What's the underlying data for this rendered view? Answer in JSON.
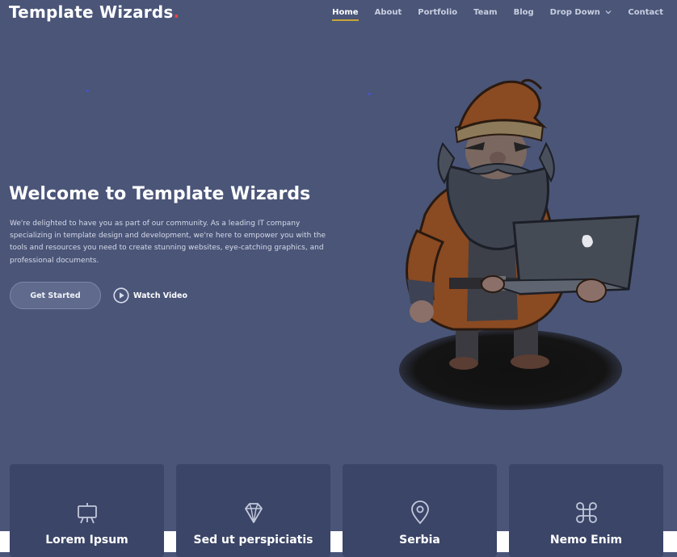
{
  "brand": {
    "name": "Template Wizards",
    "dot": ".",
    "accent_color": "#e84545"
  },
  "nav": {
    "items": [
      {
        "label": "Home",
        "active": true
      },
      {
        "label": "About"
      },
      {
        "label": "Portfolio"
      },
      {
        "label": "Team"
      },
      {
        "label": "Blog"
      },
      {
        "label": "Drop Down",
        "icon": "chevron-down-icon"
      },
      {
        "label": "Contact"
      }
    ],
    "active_underline_color": "#c8a43a"
  },
  "hero": {
    "title": "Welcome to Template Wizards",
    "text": "We're delighted to have you as part of our community. As a leading IT company specializing in template design and development, we're here to empower you with the tools and resources you need to create stunning websites, eye-catching graphics, and professional documents.",
    "primary_button": "Get Started",
    "video_button": "Watch Video",
    "illustration": "wizard-with-laptop-illustration"
  },
  "cards": [
    {
      "icon": "presentation-board-icon",
      "title": "Lorem Ipsum",
      "subtitle": ""
    },
    {
      "icon": "diamond-icon",
      "title": "Sed ut perspiciatis",
      "subtitle": ""
    },
    {
      "icon": "map-pin-icon",
      "title": "Serbia",
      "subtitle": ""
    },
    {
      "icon": "command-icon",
      "title": "Nemo Enim",
      "subtitle": ""
    }
  ],
  "colors": {
    "background": "#4a5578",
    "card_background": "#3b4567"
  }
}
